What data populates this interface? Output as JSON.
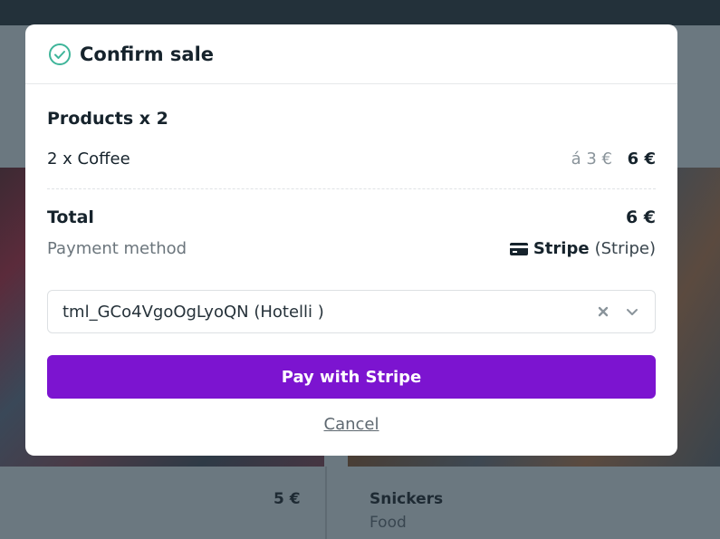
{
  "background": {
    "tile_price": "5 €",
    "tile_name": "Snickers",
    "tile_category": "Food"
  },
  "modal": {
    "title": "Confirm sale",
    "products_heading": "Products x 2",
    "line_items": [
      {
        "name": "2 x Coffee",
        "unit_price": "á 3 €",
        "total": "6 €"
      }
    ],
    "total_label": "Total",
    "total_value": "6 €",
    "payment_method_label": "Payment method",
    "payment_method_name": "Stripe",
    "payment_method_detail": "(Stripe)",
    "terminal_select": {
      "value": "tml_GCo4VgoOgLyoQN (Hotelli )"
    },
    "pay_button_label": "Pay with Stripe",
    "cancel_label": "Cancel"
  },
  "colors": {
    "accent": "#7c14d0",
    "success": "#3fb59a",
    "text": "#16232c"
  },
  "icons": {
    "title_icon": "check-circle-icon",
    "payment_icon": "credit-card-icon",
    "clear_icon": "clear-x-icon",
    "dropdown_icon": "chevron-down-icon"
  }
}
